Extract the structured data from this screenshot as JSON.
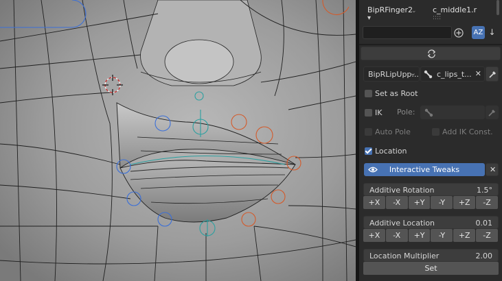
{
  "top": {
    "bone_name": "BipRFinger2",
    "bone_arrow": "▾",
    "target_name": "c_middle1.r",
    "target_dots": "::::",
    "az_label": "AZ",
    "sort_arrow": "↓"
  },
  "refresh": {
    "icon": "refresh-icon"
  },
  "pair": {
    "source_bone": "BipRLipUpp...",
    "target_bone": "c_lips_t...",
    "clear": "✕"
  },
  "options": {
    "set_as_root": "Set as Root",
    "ik": "IK",
    "pole": "Pole:",
    "auto_pole": "Auto Pole",
    "add_ik": "Add IK Const.",
    "location": "Location",
    "interactive_tweaks": "Interactive Tweaks"
  },
  "additive_rotation": {
    "label": "Additive Rotation",
    "value": "1.5°"
  },
  "additive_location": {
    "label": "Additive Location",
    "value": "0.01"
  },
  "axes": [
    "+X",
    "-X",
    "+Y",
    "-Y",
    "+Z",
    "-Z"
  ],
  "multiplier": {
    "label": "Location Multiplier",
    "value": "2.00",
    "set": "Set"
  },
  "colors": {
    "accent": "#4772b3",
    "viewport": "#8f8f8f",
    "panel": "#2b2b2b"
  }
}
